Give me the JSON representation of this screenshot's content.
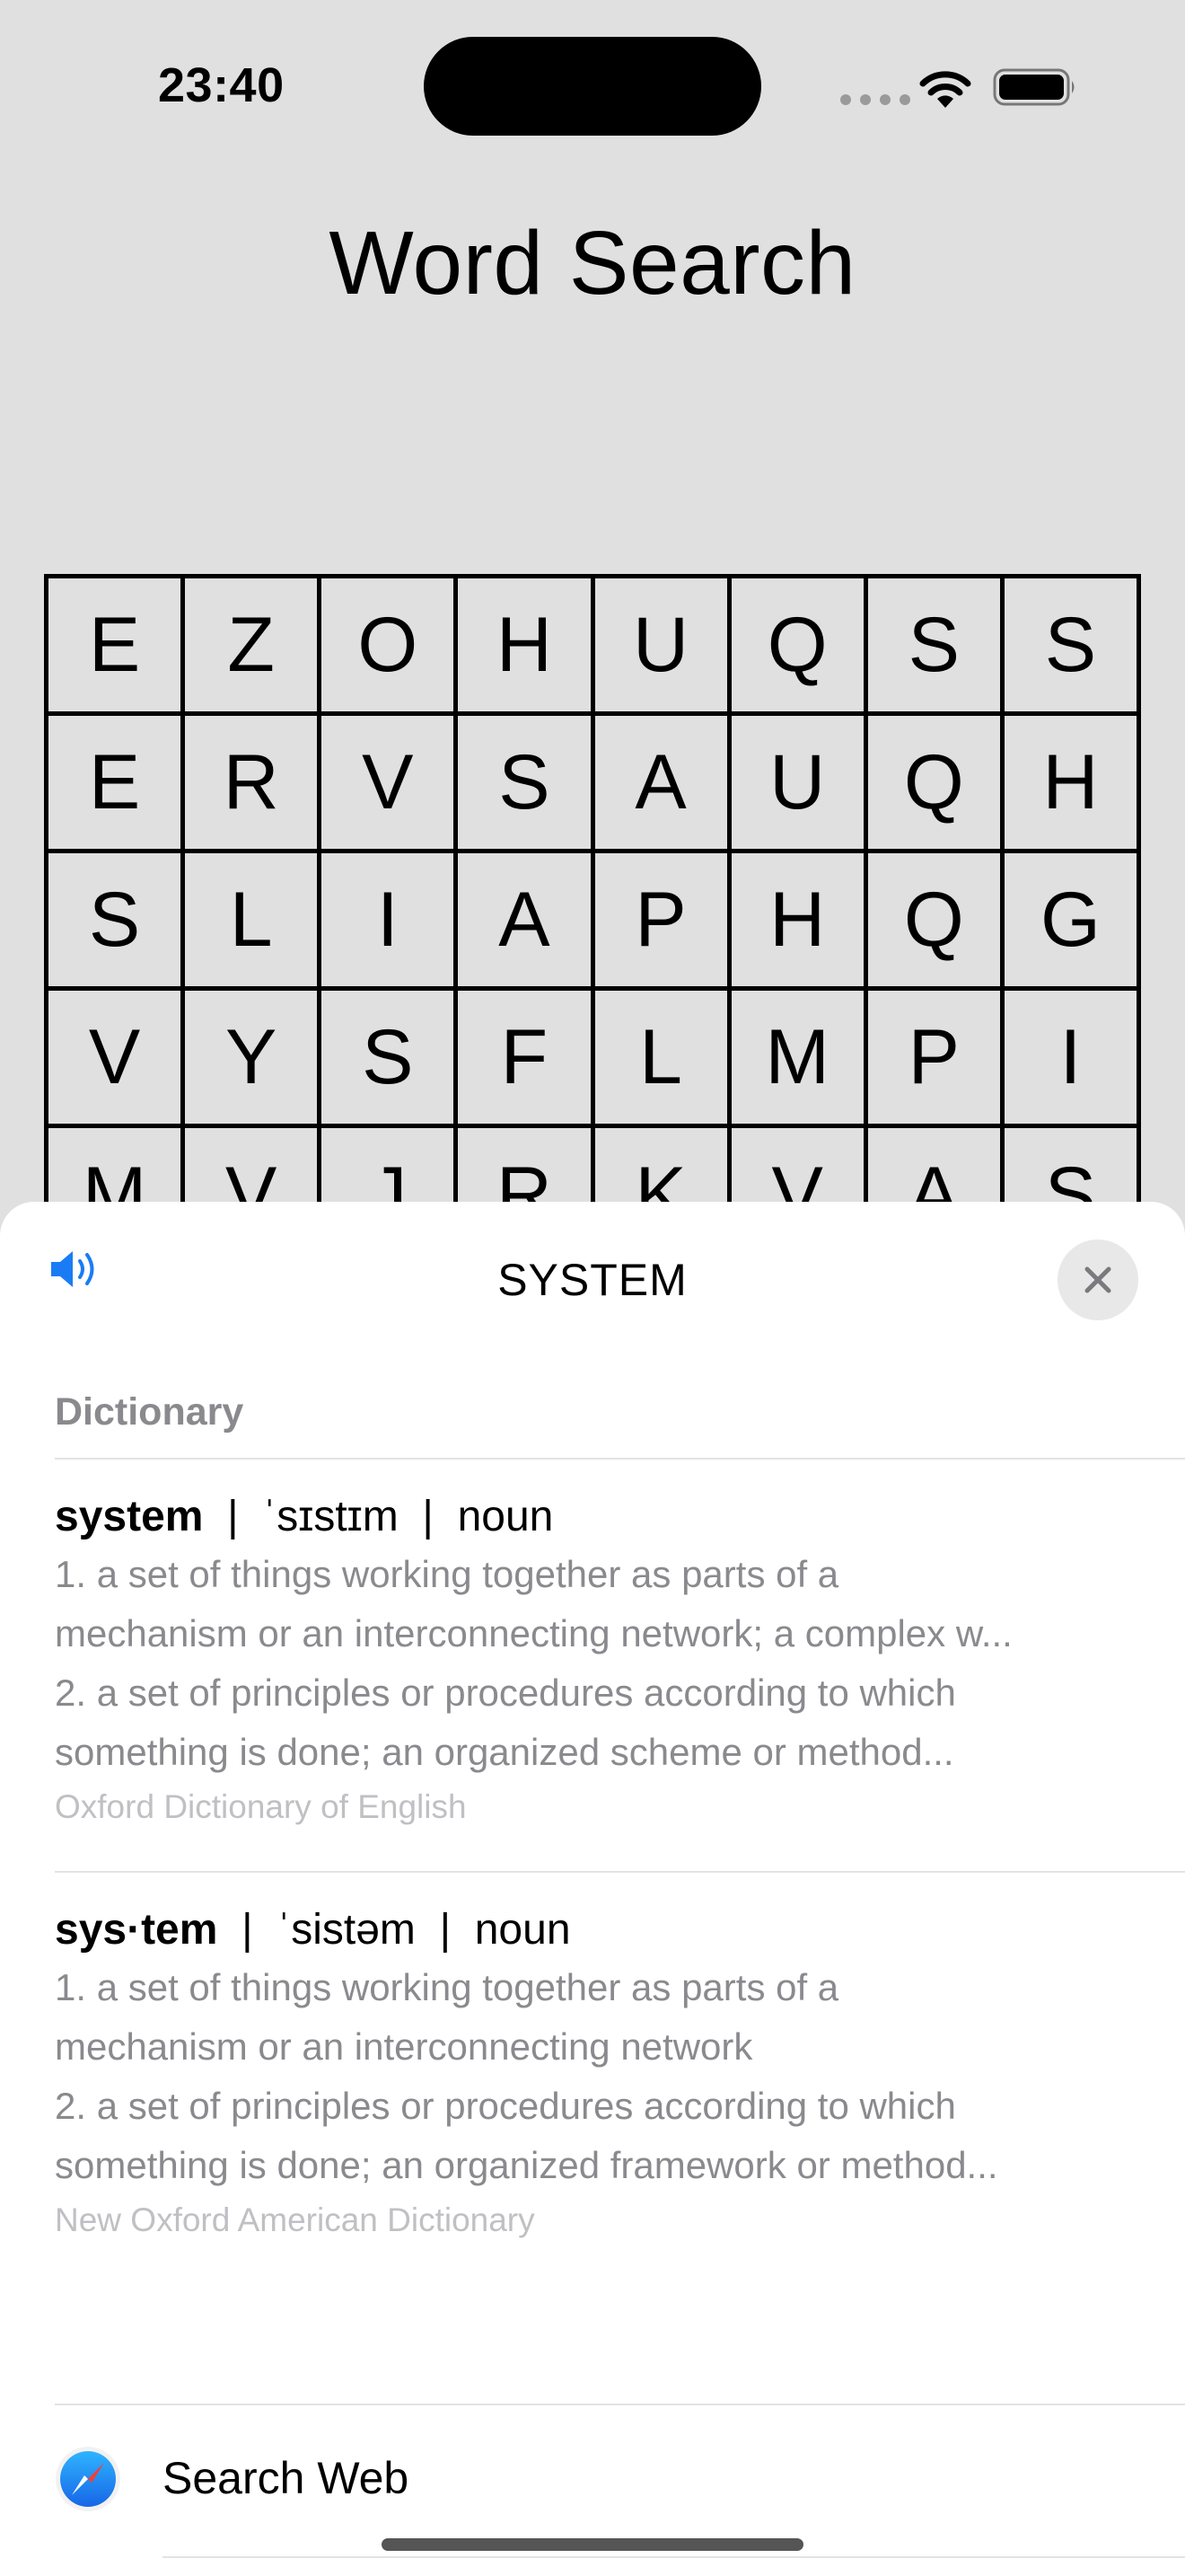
{
  "status_bar": {
    "time": "23:40",
    "icons": [
      "signal-dots-icon",
      "wifi-icon",
      "battery-icon"
    ]
  },
  "app": {
    "title": "Word Search"
  },
  "grid": {
    "rows": [
      [
        "E",
        "Z",
        "O",
        "H",
        "U",
        "Q",
        "S",
        "S"
      ],
      [
        "E",
        "R",
        "V",
        "S",
        "A",
        "U",
        "Q",
        "H"
      ],
      [
        "S",
        "L",
        "I",
        "A",
        "P",
        "H",
        "Q",
        "G"
      ],
      [
        "V",
        "Y",
        "S",
        "F",
        "L",
        "M",
        "P",
        "I"
      ],
      [
        "M",
        "V",
        "J",
        "R",
        "K",
        "V",
        "A",
        "S"
      ]
    ]
  },
  "lookup_sheet": {
    "title": "SYSTEM",
    "speaker_icon": "speaker-icon",
    "close_icon": "close-icon",
    "section_label": "Dictionary",
    "entries": [
      {
        "headword": "system",
        "pronunciation": "ˈsɪstɪm",
        "pos": "noun",
        "definitions": [
          "1. a set of things working together as parts of a",
          "mechanism or an interconnecting network; a complex w...",
          "2. a set of principles or procedures according to which",
          "something is done; an organized scheme or method..."
        ],
        "source": "Oxford Dictionary of English"
      },
      {
        "headword": "sys·tem",
        "pronunciation": "ˈsistəm",
        "pos": "noun",
        "definitions": [
          "1. a set of things working together as parts of a",
          "mechanism or an interconnecting network",
          "2. a set of principles or procedures according to which",
          "something is done; an organized framework or method..."
        ],
        "source": "New Oxford American Dictionary"
      }
    ],
    "search_web_label": "Search Web",
    "search_web_icon": "safari-icon"
  },
  "colors": {
    "background": "#e0e0e0",
    "sheet": "#ffffff",
    "accent_blue": "#1a7cf5",
    "secondary_text": "#8a8a8e",
    "tertiary_text": "#c0c0c4"
  }
}
